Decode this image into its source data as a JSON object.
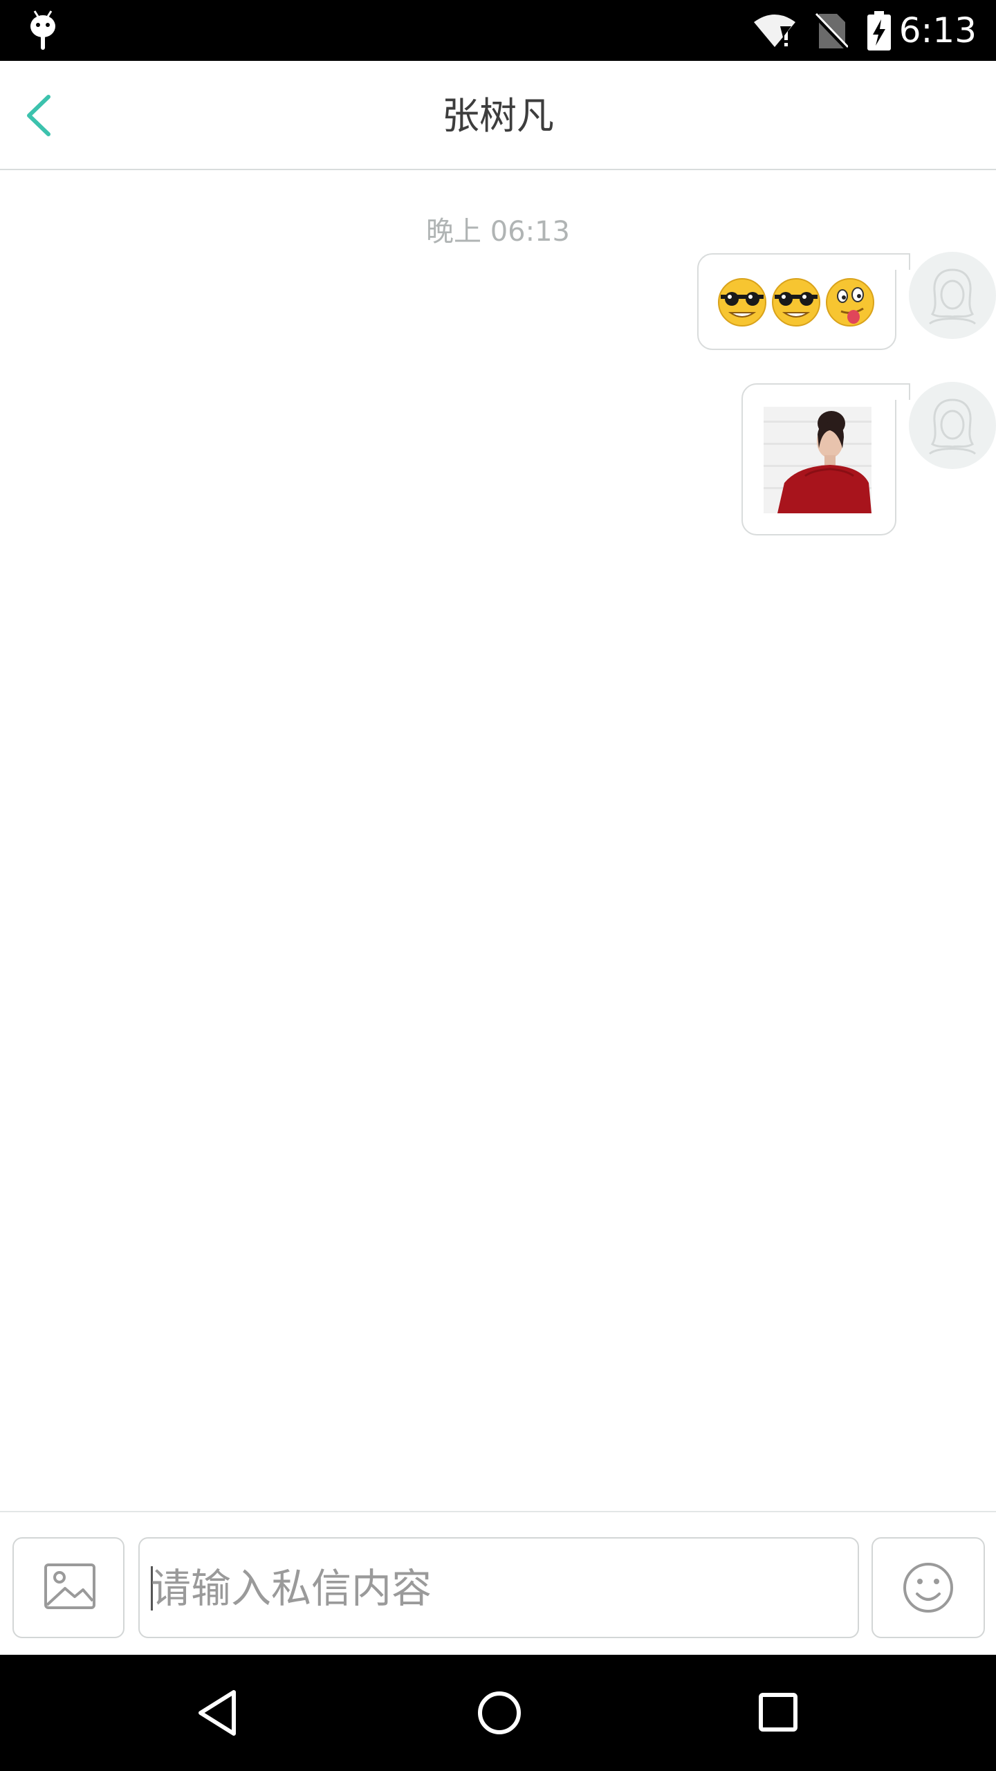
{
  "status_bar": {
    "time": "6:13",
    "icons": [
      "android-icon",
      "wifi-alert-icon",
      "no-sim-icon",
      "battery-charging-icon"
    ]
  },
  "header": {
    "title": "张树凡",
    "back_icon": "chevron-left-icon",
    "accent_color": "#3cc2ad"
  },
  "chat": {
    "timestamp": "晚上 06:13",
    "messages": [
      {
        "type": "emoji",
        "content": [
          "cool-sunglasses-emoji",
          "cool-sunglasses-emoji",
          "tongue-out-emoji"
        ],
        "sender": "self"
      },
      {
        "type": "image",
        "content": "photo-woman-red-top",
        "sender": "self"
      }
    ]
  },
  "input_bar": {
    "placeholder": "请输入私信内容",
    "value": "",
    "image_icon": "image-icon",
    "emoji_icon": "smiley-icon"
  },
  "nav_bar": {
    "icons": [
      "back-triangle-icon",
      "home-circle-icon",
      "recents-square-icon"
    ]
  }
}
